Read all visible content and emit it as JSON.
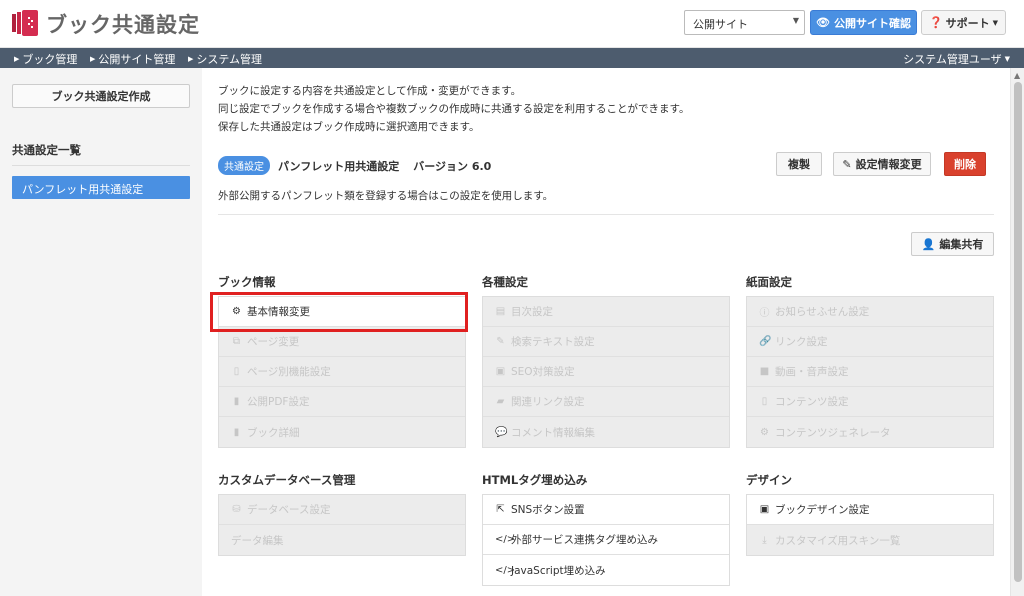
{
  "app": {
    "title": "ブック共通設定",
    "site_select": "公開サイト",
    "site_button": "公開サイト確認",
    "support_button": "サポート"
  },
  "nav": {
    "items": [
      "ブック管理",
      "公開サイト管理",
      "システム管理"
    ],
    "user": "システム管理ユーザ"
  },
  "sidebar": {
    "create_button": "ブック共通設定作成",
    "heading": "共通設定一覧",
    "items": [
      "パンフレット用共通設定"
    ]
  },
  "main": {
    "intro": [
      "ブックに設定する内容を共通設定として作成・変更ができます。",
      "同じ設定でブックを作成する場合や複数ブックの作成時に共通する設定を利用することができます。",
      "保存した共通設定はブック作成時に選択適用できます。"
    ],
    "badge": "共通設定",
    "name": "パンフレット用共通設定",
    "version": "バージョン 6.0",
    "copy_button": "複製",
    "edit_info_button": "設定情報変更",
    "delete_button": "削除",
    "description": "外部公開するパンフレット類を登録する場合はこの設定を使用します。",
    "share_button": "編集共有"
  },
  "groups": [
    {
      "title": "ブック情報",
      "items": [
        {
          "label": "基本情報変更",
          "icon": "gear-icon",
          "active": true
        },
        {
          "label": "ページ変更",
          "icon": "copy-icon",
          "active": false
        },
        {
          "label": "ページ別機能設定",
          "icon": "file-icon",
          "active": false
        },
        {
          "label": "公開PDF設定",
          "icon": "file-pdf-icon",
          "active": false
        },
        {
          "label": "ブック詳細",
          "icon": "book-icon",
          "active": false
        }
      ]
    },
    {
      "title": "各種設定",
      "items": [
        {
          "label": "目次設定",
          "icon": "list-icon",
          "active": false
        },
        {
          "label": "検索テキスト設定",
          "icon": "edit-icon",
          "active": false
        },
        {
          "label": "SEO対策設定",
          "icon": "image-icon",
          "active": false
        },
        {
          "label": "関連リンク設定",
          "icon": "bookmark-icon",
          "active": false
        },
        {
          "label": "コメント情報編集",
          "icon": "comment-icon",
          "active": false
        }
      ]
    },
    {
      "title": "紙面設定",
      "items": [
        {
          "label": "お知らせふせん設定",
          "icon": "info-icon",
          "active": false
        },
        {
          "label": "リンク設定",
          "icon": "link-icon",
          "active": false
        },
        {
          "label": "動画・音声設定",
          "icon": "video-icon",
          "active": false
        },
        {
          "label": "コンテンツ設定",
          "icon": "trash-icon",
          "active": false
        },
        {
          "label": "コンテンツジェネレータ",
          "icon": "cogs-icon",
          "active": false
        }
      ]
    },
    {
      "title": "カスタムデータベース管理",
      "items": [
        {
          "label": "データベース設定",
          "icon": "sitemap-icon",
          "active": false
        },
        {
          "label": "データ編集",
          "icon": "",
          "active": false
        }
      ]
    },
    {
      "title": "HTMLタグ埋め込み",
      "items": [
        {
          "label": "SNSボタン設置",
          "icon": "share-icon",
          "active": true
        },
        {
          "label": "外部サービス連携タグ埋め込み",
          "icon": "code-icon",
          "active": true
        },
        {
          "label": "JavaScript埋め込み",
          "icon": "code-icon",
          "active": true
        }
      ]
    },
    {
      "title": "デザイン",
      "items": [
        {
          "label": "ブックデザイン設定",
          "icon": "picture-icon",
          "active": true
        },
        {
          "label": "カスタマイズ用スキン一覧",
          "icon": "download-icon",
          "active": false
        }
      ]
    }
  ]
}
